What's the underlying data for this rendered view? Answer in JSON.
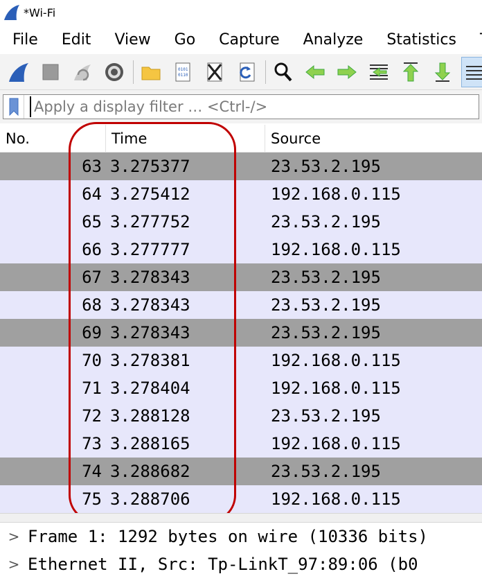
{
  "window": {
    "title": "*Wi-Fi",
    "app_icon": "wireshark-fin-icon"
  },
  "menubar": {
    "items": [
      "File",
      "Edit",
      "View",
      "Go",
      "Capture",
      "Analyze",
      "Statistics",
      "Te"
    ]
  },
  "toolbar": {
    "buttons": [
      "start-capture-icon",
      "stop-capture-icon",
      "restart-capture-icon",
      "capture-options-icon",
      "open-file-icon",
      "save-file-icon",
      "close-file-icon",
      "reload-file-icon",
      "find-packet-icon",
      "go-back-icon",
      "go-forward-icon",
      "go-to-packet-icon",
      "first-packet-icon",
      "last-packet-icon",
      "autoscroll-icon"
    ],
    "colors": {
      "blue": "#2b5fb8",
      "green": "#3fa83f",
      "yellow": "#f5c542"
    }
  },
  "filter": {
    "placeholder": "Apply a display filter … <Ctrl-/>"
  },
  "packet_list": {
    "columns": {
      "no": "No.",
      "time": "Time",
      "source": "Source"
    },
    "rows": [
      {
        "no": "63",
        "time": "3.275377",
        "source": "23.53.2.195",
        "shade": "dark"
      },
      {
        "no": "64",
        "time": "3.275412",
        "source": "192.168.0.115",
        "shade": "light"
      },
      {
        "no": "65",
        "time": "3.277752",
        "source": "23.53.2.195",
        "shade": "light"
      },
      {
        "no": "66",
        "time": "3.277777",
        "source": "192.168.0.115",
        "shade": "light"
      },
      {
        "no": "67",
        "time": "3.278343",
        "source": "23.53.2.195",
        "shade": "dark"
      },
      {
        "no": "68",
        "time": "3.278343",
        "source": "23.53.2.195",
        "shade": "light"
      },
      {
        "no": "69",
        "time": "3.278343",
        "source": "23.53.2.195",
        "shade": "dark"
      },
      {
        "no": "70",
        "time": "3.278381",
        "source": "192.168.0.115",
        "shade": "light"
      },
      {
        "no": "71",
        "time": "3.278404",
        "source": "192.168.0.115",
        "shade": "light"
      },
      {
        "no": "72",
        "time": "3.288128",
        "source": "23.53.2.195",
        "shade": "light"
      },
      {
        "no": "73",
        "time": "3.288165",
        "source": "192.168.0.115",
        "shade": "light"
      },
      {
        "no": "74",
        "time": "3.288682",
        "source": "23.53.2.195",
        "shade": "dark"
      },
      {
        "no": "75",
        "time": "3.288706",
        "source": "192.168.0.115",
        "shade": "light"
      }
    ],
    "row_colors": {
      "light": "#e7e7fb",
      "dark": "#a0a0a0"
    },
    "annotation_color": "#c00000"
  },
  "details": {
    "rows": [
      {
        "chevron": ">",
        "text": "Frame 1: 1292 bytes on wire (10336 bits)"
      },
      {
        "chevron": ">",
        "text": "Ethernet II, Src: Tp-LinkT_97:89:06 (b0"
      }
    ]
  }
}
